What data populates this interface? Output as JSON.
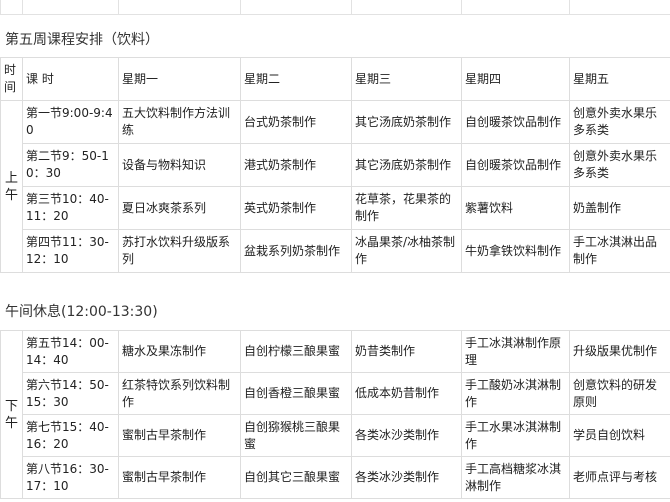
{
  "page": {
    "title": "第五周课程安排（饮料）",
    "break_label": "午间休息(12:00-13:30)"
  },
  "headers": [
    "时间",
    "课 时",
    "星期一",
    "星期二",
    "星期三",
    "星期四",
    "星期五"
  ],
  "morning": {
    "label": "上午",
    "rows": [
      {
        "time": "第一节9:00-9:40",
        "cells": [
          "五大饮料制作方法训练",
          "台式奶茶制作",
          "其它汤底奶茶制作",
          "自创暖茶饮品制作",
          "创意外卖水果乐多系类"
        ]
      },
      {
        "time": "第二节9：50-10：30",
        "cells": [
          "设备与物料知识",
          "港式奶茶制作",
          "其它汤底奶茶制作",
          "自创暖茶饮品制作",
          "创意外卖水果乐多系类"
        ]
      },
      {
        "time": "第三节10：40-11：20",
        "cells": [
          "夏日冰爽茶系列",
          "英式奶茶制作",
          "花草茶，花果茶的制作",
          "紫薯饮料",
          "奶盖制作"
        ]
      },
      {
        "time": "第四节11：30-12：10",
        "cells": [
          "苏打水饮料升级版系列",
          "盆栽系列奶茶制作",
          "冰晶果茶/冰柚茶制作",
          "牛奶拿铁饮料制作",
          "手工冰淇淋出品制作"
        ]
      }
    ]
  },
  "afternoon": {
    "label": "下午",
    "rows": [
      {
        "time": "第五节14：00-14：40",
        "cells": [
          "糖水及果冻制作",
          "自创柠檬三酿果蜜",
          "奶昔类制作",
          "手工冰淇淋制作原理",
          "升级版果优制作"
        ]
      },
      {
        "time": "第六节14：50-15：30",
        "cells": [
          "红茶特饮系列饮料制作",
          "自创香橙三酿果蜜",
          "低成本奶昔制作",
          "手工酸奶冰淇淋制作",
          "创意饮料的研发原则"
        ]
      },
      {
        "time": "第七节15：40-16：20",
        "cells": [
          "蜜制古早茶制作",
          "自创猕猴桃三酿果蜜",
          "各类冰沙类制作",
          "手工水果冰淇淋制作",
          "学员自创饮料"
        ]
      },
      {
        "time": "第八节16：30-17：10",
        "cells": [
          "蜜制古早茶制作",
          "自创其它三酿果蜜",
          "各类冰沙类制作",
          "手工高档糖浆冰淇淋制作",
          "老师点评与考核"
        ]
      }
    ]
  }
}
